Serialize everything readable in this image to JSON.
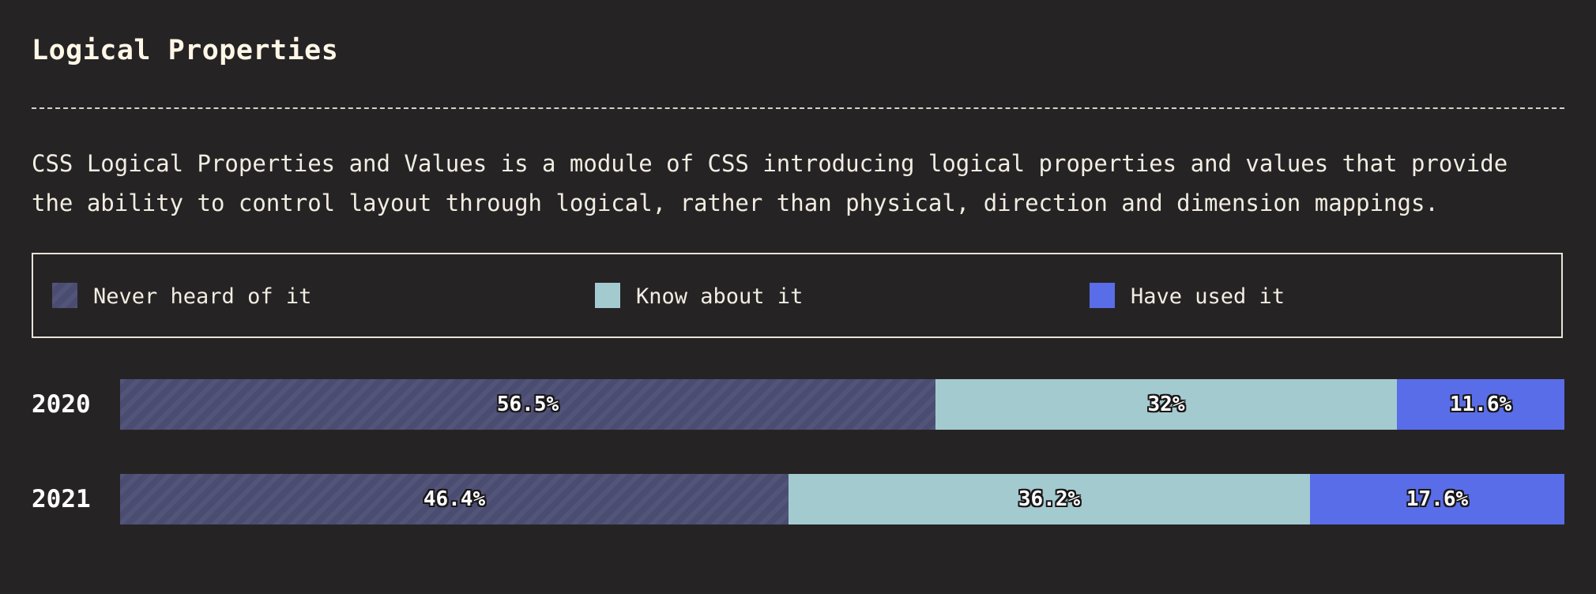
{
  "title": "Logical Properties",
  "description": {
    "line1": "CSS Logical Properties and Values is a module of CSS introducing logical properties and values that provide",
    "line2": "the ability to control layout through logical, rather than physical, direction and dimension mappings."
  },
  "legend": [
    {
      "label": "Never heard of it",
      "color": "#4a4c72"
    },
    {
      "label": "Know about it",
      "color": "#a3cbcf"
    },
    {
      "label": "Have used it",
      "color": "#5a6de8"
    }
  ],
  "chart_data": {
    "type": "bar",
    "orientation": "horizontal",
    "stacked": "100%",
    "categories": [
      "2020",
      "2021"
    ],
    "series": [
      {
        "name": "Never heard of it",
        "values": [
          56.5,
          46.4
        ],
        "labels": [
          "56.5%",
          "46.4%"
        ],
        "color": "#4a4c72"
      },
      {
        "name": "Know about it",
        "values": [
          32,
          36.2
        ],
        "labels": [
          "32%",
          "36.2%"
        ],
        "color": "#a3cbcf"
      },
      {
        "name": "Have used it",
        "values": [
          11.6,
          17.6
        ],
        "labels": [
          "11.6%",
          "17.6%"
        ],
        "color": "#5a6de8"
      }
    ],
    "xlim": [
      0,
      100
    ],
    "grid": false,
    "legend_position": "top"
  }
}
